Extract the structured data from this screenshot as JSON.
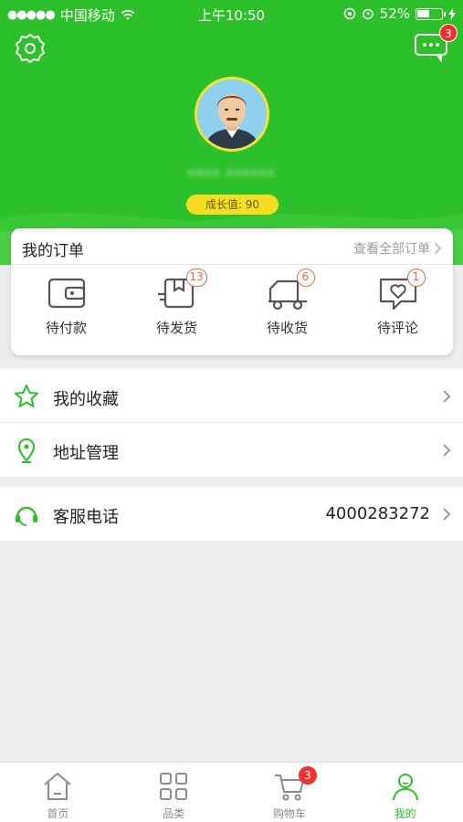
{
  "status_bar": {
    "signal_dots": "●●●●●",
    "carrier": "中国移动",
    "time": "上午10:50",
    "battery": "52%",
    "battery_level": 0.52
  },
  "header": {
    "message_badge": "3",
    "username": "**** ******",
    "growth_value": "成长值: 90",
    "brand_color": "#2cc02a"
  },
  "orders": {
    "title": "我的订单",
    "view_all": "查看全部订单",
    "items": [
      {
        "label": "待付款",
        "icon": "wallet-icon",
        "badge": ""
      },
      {
        "label": "待发货",
        "icon": "package-icon",
        "badge": "13"
      },
      {
        "label": "待收货",
        "icon": "delivery-truck-icon",
        "badge": "6"
      },
      {
        "label": "待评论",
        "icon": "review-heart-icon",
        "badge": "1"
      }
    ]
  },
  "menu": {
    "favorites": "我的收藏",
    "address": "地址管理",
    "service": "客服电话",
    "service_phone": "4000283272"
  },
  "tabbar": {
    "items": [
      {
        "label": "首页",
        "icon": "home-icon"
      },
      {
        "label": "品类",
        "icon": "category-grid-icon"
      },
      {
        "label": "购物车",
        "icon": "cart-icon",
        "badge": "3"
      },
      {
        "label": "我的",
        "icon": "user-icon",
        "active": true
      }
    ]
  }
}
